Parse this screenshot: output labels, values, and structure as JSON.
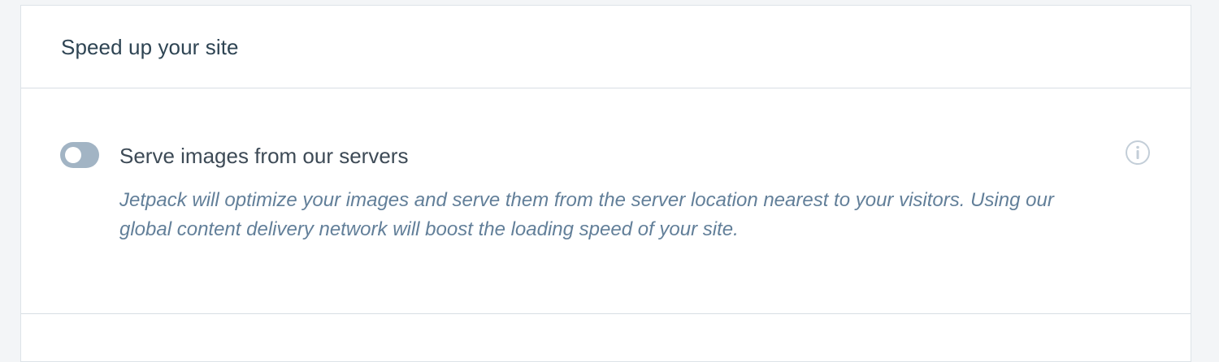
{
  "card": {
    "title": "Speed up your site"
  },
  "setting": {
    "toggle_state": "off",
    "label": "Serve images from our servers",
    "description": "Jetpack will optimize your images and serve them from the server location nearest to your visitors. Using our global content delivery network will boost the loading speed of your site.",
    "info_icon": "info-circle-icon"
  },
  "colors": {
    "page_background": "#f3f5f7",
    "card_background": "#ffffff",
    "toggle_off": "#a2b4c4",
    "description_text": "#627f99",
    "title_text": "#2e4453"
  }
}
